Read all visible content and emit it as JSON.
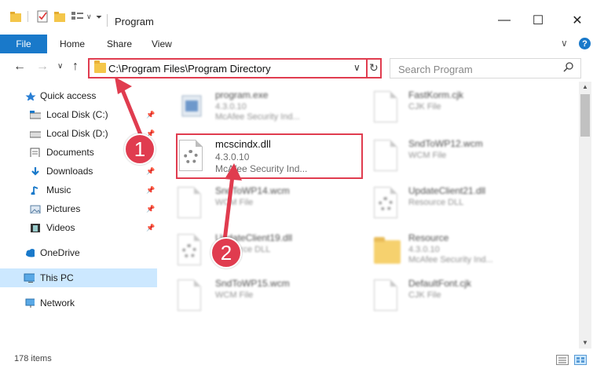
{
  "window": {
    "title": "Program",
    "minimize_glyph": "—",
    "maximize_glyph": "☐",
    "close_glyph": "✕"
  },
  "ribbon": {
    "file_tab": "File",
    "tabs": [
      "Home",
      "Share",
      "View"
    ],
    "expand_glyph": "∨",
    "help_glyph": "?"
  },
  "navigation": {
    "back_glyph": "←",
    "forward_glyph": "→",
    "recent_glyph": "∨",
    "up_glyph": "↑",
    "address": "C:\\Program Files\\Program Directory",
    "address_dropdown_glyph": "∨",
    "refresh_glyph": "↻",
    "search_placeholder": "Search Program",
    "search_glyph": "⚲"
  },
  "sidebar": {
    "quick_access": "Quick access",
    "items": [
      {
        "label": "Local Disk (C:)",
        "icon": "drive-icon",
        "pinned": true
      },
      {
        "label": "Local Disk (D:)",
        "icon": "drive-icon",
        "pinned": true
      },
      {
        "label": "Documents",
        "icon": "documents-icon",
        "pinned": true
      },
      {
        "label": "Downloads",
        "icon": "downloads-icon",
        "pinned": true
      },
      {
        "label": "Music",
        "icon": "music-icon",
        "pinned": true
      },
      {
        "label": "Pictures",
        "icon": "pictures-icon",
        "pinned": true
      },
      {
        "label": "Videos",
        "icon": "videos-icon",
        "pinned": true
      }
    ],
    "onedrive": "OneDrive",
    "this_pc": "This PC",
    "network": "Network",
    "pin_glyph": "📌"
  },
  "files": [
    {
      "name": "program.exe",
      "line1": "4.3.0.10",
      "line2": "McAfee Security Ind...",
      "icon": "exe-icon"
    },
    {
      "name": "FastKorm.cjk",
      "line1": "CJK File",
      "line2": "",
      "icon": "document-icon"
    },
    {
      "name": "mcscindx.dll",
      "line1": "4.3.0.10",
      "line2": "McAfee Security Ind...",
      "icon": "dll-gear-icon"
    },
    {
      "name": "SndToWP12.wcm",
      "line1": "WCM File",
      "line2": "",
      "icon": "document-icon"
    },
    {
      "name": "SndToWP14.wcm",
      "line1": "WCM File",
      "line2": "",
      "icon": "document-icon"
    },
    {
      "name": "UpdateClient21.dll",
      "line1": "Resource DLL",
      "line2": "",
      "icon": "dll-gear-icon"
    },
    {
      "name": "UpdateClient19.dll",
      "line1": "Resource DLL",
      "line2": "",
      "icon": "dll-gear-icon"
    },
    {
      "name": "Resource",
      "line1": "4.3.0.10",
      "line2": "McAfee Security Ind...",
      "icon": "folder-icon"
    },
    {
      "name": "SndToWP15.wcm",
      "line1": "WCM File",
      "line2": "",
      "icon": "document-icon"
    },
    {
      "name": "DefaultFont.cjk",
      "line1": "CJK File",
      "line2": "",
      "icon": "document-icon"
    }
  ],
  "callouts": {
    "step1": "1",
    "step2": "2",
    "color": "#e03c4f"
  },
  "status": {
    "item_count": "178 items"
  },
  "colors": {
    "accent": "#1979ca",
    "highlight": "#e03c4f",
    "selected": "#cce8ff"
  }
}
